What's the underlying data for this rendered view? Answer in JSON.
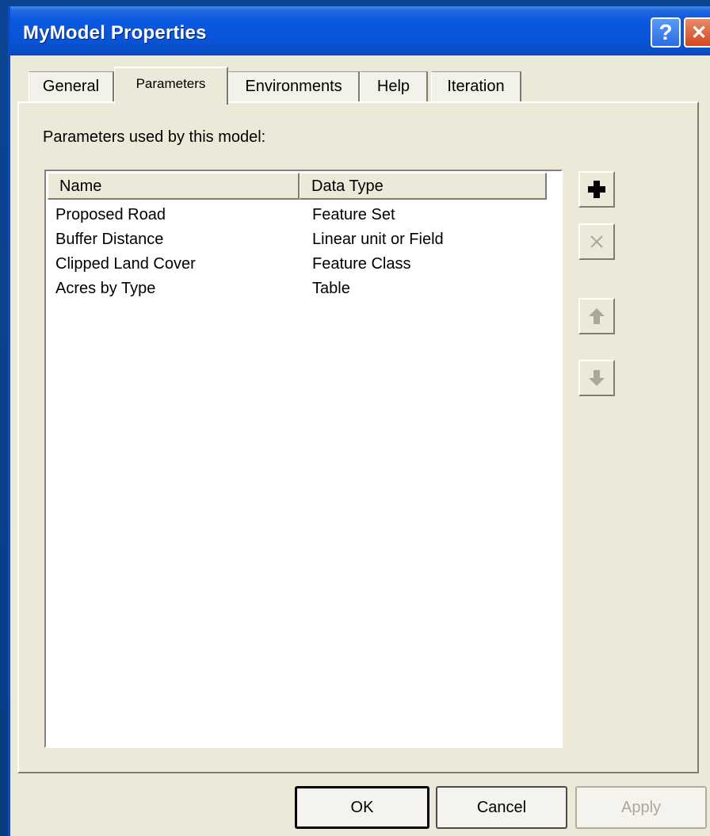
{
  "window": {
    "title": "MyModel Properties",
    "help_button_label": "?",
    "close_button_label": "✕"
  },
  "tabs": [
    {
      "label": "General",
      "active": false
    },
    {
      "label": "Parameters",
      "active": true
    },
    {
      "label": "Environments",
      "active": false
    },
    {
      "label": "Help",
      "active": false
    },
    {
      "label": "Iteration",
      "active": false
    }
  ],
  "panel": {
    "caption": "Parameters used by this model:",
    "columns": [
      "Name",
      "Data Type"
    ],
    "rows": [
      {
        "name": "Proposed Road",
        "data_type": "Feature Set"
      },
      {
        "name": "Buffer Distance",
        "data_type": "Linear unit or Field"
      },
      {
        "name": "Clipped Land Cover",
        "data_type": "Feature Class"
      },
      {
        "name": "Acres by Type",
        "data_type": "Table"
      }
    ]
  },
  "side_buttons": [
    {
      "icon": "plus-icon",
      "enabled": true
    },
    {
      "icon": "x-icon",
      "enabled": false
    },
    {
      "icon": "arrow-up-icon",
      "enabled": false
    },
    {
      "icon": "arrow-down-icon",
      "enabled": false
    }
  ],
  "buttons": {
    "ok": "OK",
    "cancel": "Cancel",
    "apply": "Apply"
  },
  "colors": {
    "title_bar": "#0a58e2",
    "dialog_face": "#ece9d8",
    "desktop": "#0a3b80"
  }
}
